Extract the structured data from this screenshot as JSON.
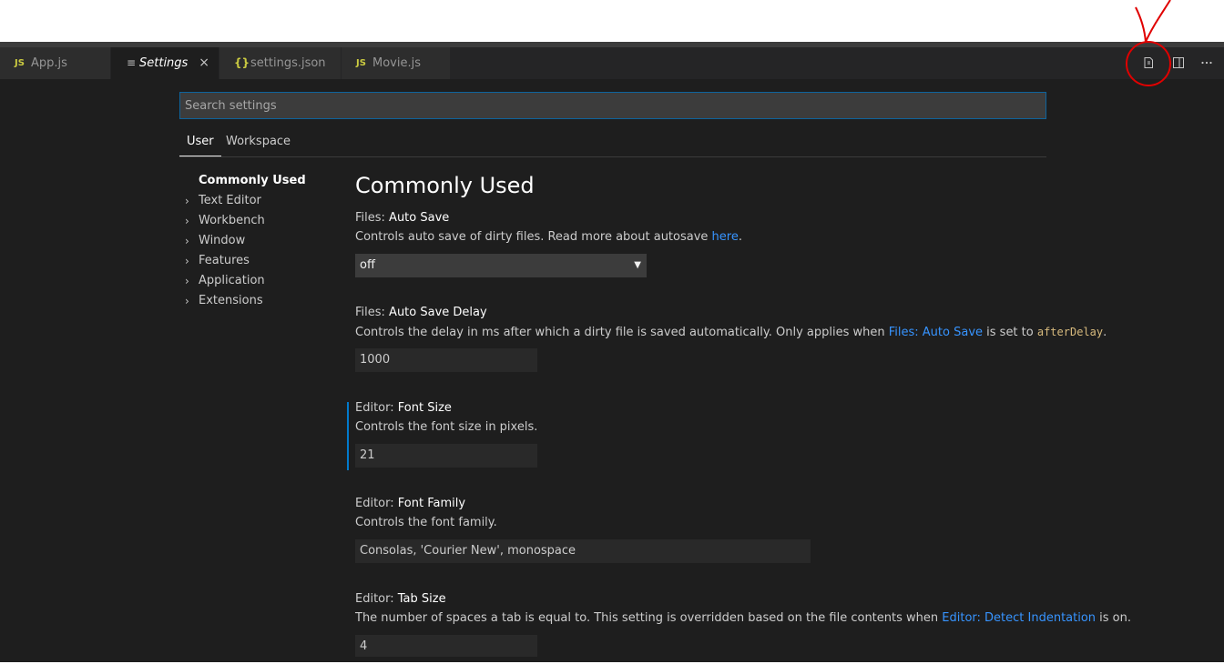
{
  "tabs": [
    {
      "icon": "JS",
      "label": "App.js"
    },
    {
      "icon": "menu",
      "label": "Settings"
    },
    {
      "icon": "{}",
      "label": "settings.json"
    },
    {
      "icon": "JS",
      "label": "Movie.js"
    }
  ],
  "tab_close_glyph": "×",
  "search": {
    "placeholder": "Search settings"
  },
  "scopes": [
    "User",
    "Workspace"
  ],
  "toc": [
    "Commonly Used",
    "Text Editor",
    "Workbench",
    "Window",
    "Features",
    "Application",
    "Extensions"
  ],
  "section_title": "Commonly Used",
  "settings": [
    {
      "category": "Files: ",
      "name": "Auto Save",
      "desc_pre": "Controls auto save of dirty files. Read more about autosave ",
      "desc_link": "here",
      "desc_post": ".",
      "value": "off"
    },
    {
      "category": "Files: ",
      "name": "Auto Save Delay",
      "desc_pre": "Controls the delay in ms after which a dirty file is saved automatically. Only applies when ",
      "desc_link": "Files: Auto Save",
      "desc_mid": " is set to ",
      "desc_code": "afterDelay",
      "desc_post": ".",
      "value": "1000"
    },
    {
      "category": "Editor: ",
      "name": "Font Size",
      "desc": "Controls the font size in pixels.",
      "value": "21"
    },
    {
      "category": "Editor: ",
      "name": "Font Family",
      "desc": "Controls the font family.",
      "value": "Consolas, 'Courier New', monospace"
    },
    {
      "category": "Editor: ",
      "name": "Tab Size",
      "desc_pre": "The number of spaces a tab is equal to. This setting is overridden based on the file contents when ",
      "desc_link": "Editor: Detect Indentation",
      "desc_post": " is on.",
      "value": "4"
    }
  ],
  "colors": {
    "background": "#1e1e1e",
    "tabbar": "#252526",
    "link": "#3794ff",
    "focus": "#007acc",
    "annotation": "#e00000"
  },
  "annotation_icon": "red-circle-with-arrow"
}
